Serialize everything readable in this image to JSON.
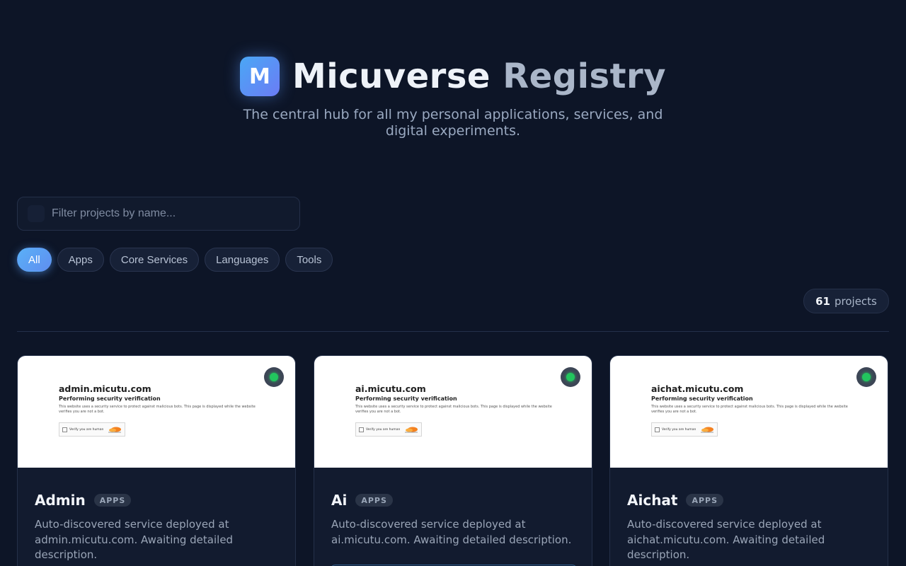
{
  "header": {
    "logo_letter": "M",
    "title_main": "Micuverse",
    "title_accent": "Registry",
    "subtitle": "The central hub for all my personal applications, services, and digital experiments."
  },
  "search": {
    "placeholder": "Filter projects by name...",
    "value": ""
  },
  "filters": [
    {
      "label": "All",
      "active": true
    },
    {
      "label": "Apps",
      "active": false
    },
    {
      "label": "Core Services",
      "active": false
    },
    {
      "label": "Languages",
      "active": false
    },
    {
      "label": "Tools",
      "active": false
    }
  ],
  "count": {
    "value": "61",
    "label": "projects"
  },
  "preview_common": {
    "subtitle": "Performing security verification",
    "text": "This website uses a security service to protect against malicious bots. This page is displayed while the website verifies you are not a bot.",
    "widget_label": "Verify you are human"
  },
  "cards": [
    {
      "name": "Admin",
      "tag": "APPS",
      "host": "admin.micutu.com",
      "description": "Auto-discovered service deployed at admin.micutu.com. Awaiting detailed description.",
      "status_color": "#22c55e"
    },
    {
      "name": "Ai",
      "tag": "APPS",
      "host": "ai.micutu.com",
      "description": "Auto-discovered service deployed at ai.micutu.com. Awaiting detailed description.",
      "status_color": "#22c55e"
    },
    {
      "name": "Aichat",
      "tag": "APPS",
      "host": "aichat.micutu.com",
      "description": "Auto-discovered service deployed at aichat.micutu.com. Awaiting detailed description.",
      "status_color": "#22c55e"
    }
  ],
  "colors": {
    "accent": "#5ab0f7",
    "background": "#0d1527",
    "status_online": "#22c55e"
  }
}
